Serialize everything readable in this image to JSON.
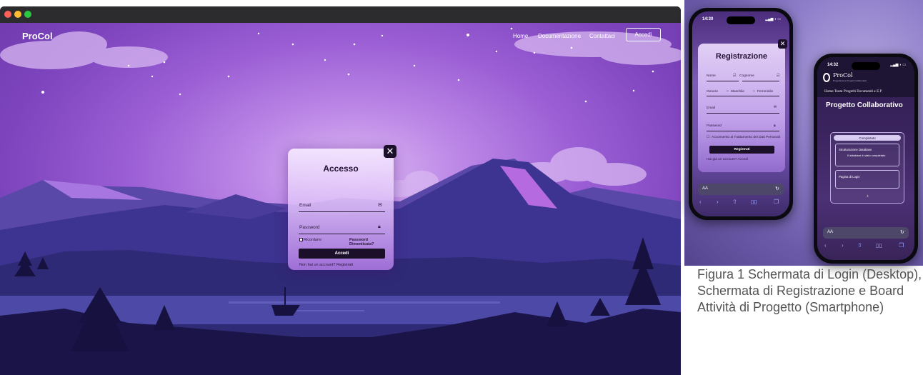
{
  "desktop": {
    "brand": "ProCol",
    "nav": {
      "home": "Home",
      "docs": "Documentazione",
      "contacts": "Contattaci",
      "login": "Accedi"
    },
    "login_card": {
      "close": "✕",
      "title": "Accesso",
      "email_placeholder": "Email",
      "password_placeholder": "Password",
      "remember": "Ricordami",
      "forgot": "Password Dimenticata?",
      "submit": "Accedi",
      "register_prompt": "Non hai un account? Registrati"
    }
  },
  "phone_registration": {
    "time": "14:30",
    "title": "Registrazione",
    "close": "✕",
    "fields": {
      "name": "Nome",
      "surname": "Cognome",
      "gender": "Genere",
      "male": "Maschile",
      "female": "Femminile",
      "email": "Email",
      "password": "Password"
    },
    "privacy": "Acconsento al Trattamento dei Dati Personali",
    "submit": "Registrati",
    "login_prompt": "Hai già un account? Accedi",
    "url_text": "AA"
  },
  "phone_board": {
    "time": "14:32",
    "brand": "ProCol",
    "brand_sub": "Progettazione Progetti Collaborativi",
    "nav": "Home   Team   Progetti   Documenti ▾   E.P",
    "title": "Progetto Collaborativo",
    "board_header": "Completato",
    "tasks": [
      {
        "title": "Strutturazione Database",
        "subtitle": "Il database è stato completato"
      },
      {
        "title": "Pagina di Login"
      }
    ],
    "add": "+",
    "url_text": "AA"
  },
  "caption": "Figura 1 Schermata di Login (Desktop), Schermata di Registrazione e Board Attività di Progetto (Smartphone)",
  "colors": {
    "accent": "#1b0f2a",
    "sky": "#a66bd9",
    "mountain": "#3c2d85",
    "caption": "#545454"
  },
  "icons": [
    "close-icon",
    "mail-icon",
    "lock-icon",
    "user-icon",
    "reload-icon",
    "share-icon",
    "bookmarks-icon",
    "tabs-icon"
  ]
}
